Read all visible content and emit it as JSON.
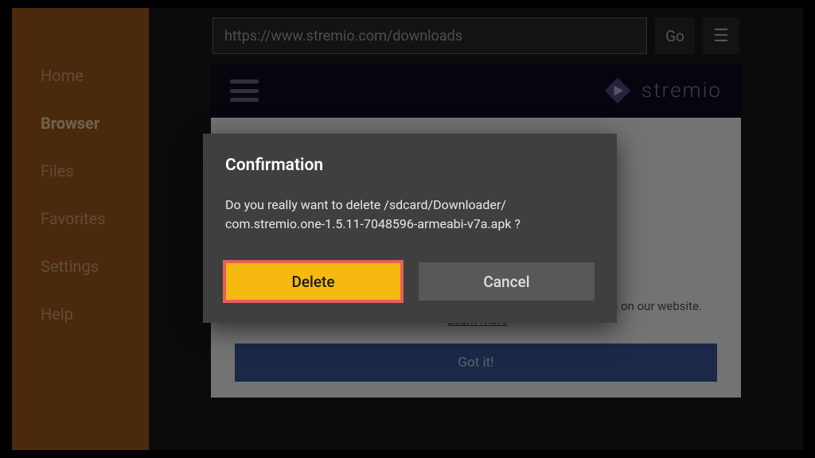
{
  "sidebar": {
    "items": [
      {
        "label": "Home",
        "active": false
      },
      {
        "label": "Browser",
        "active": true
      },
      {
        "label": "Files",
        "active": false
      },
      {
        "label": "Favorites",
        "active": false
      },
      {
        "label": "Settings",
        "active": false
      },
      {
        "label": "Help",
        "active": false
      }
    ]
  },
  "urlbar": {
    "value": "https://www.stremio.com/downloads",
    "go_label": "Go"
  },
  "webpage": {
    "brand": "stremio",
    "cookie_text": "The Stremio team uses cookies to ensure you get the best experience on our website.",
    "cookie_link": "Learn more",
    "gotit_label": "Got it!"
  },
  "dialog": {
    "title": "Confirmation",
    "message": "Do you really want to delete /sdcard/Downloader/ com.stremio.one-1.5.11-7048596-armeabi-v7a.apk ?",
    "delete_label": "Delete",
    "cancel_label": "Cancel"
  }
}
